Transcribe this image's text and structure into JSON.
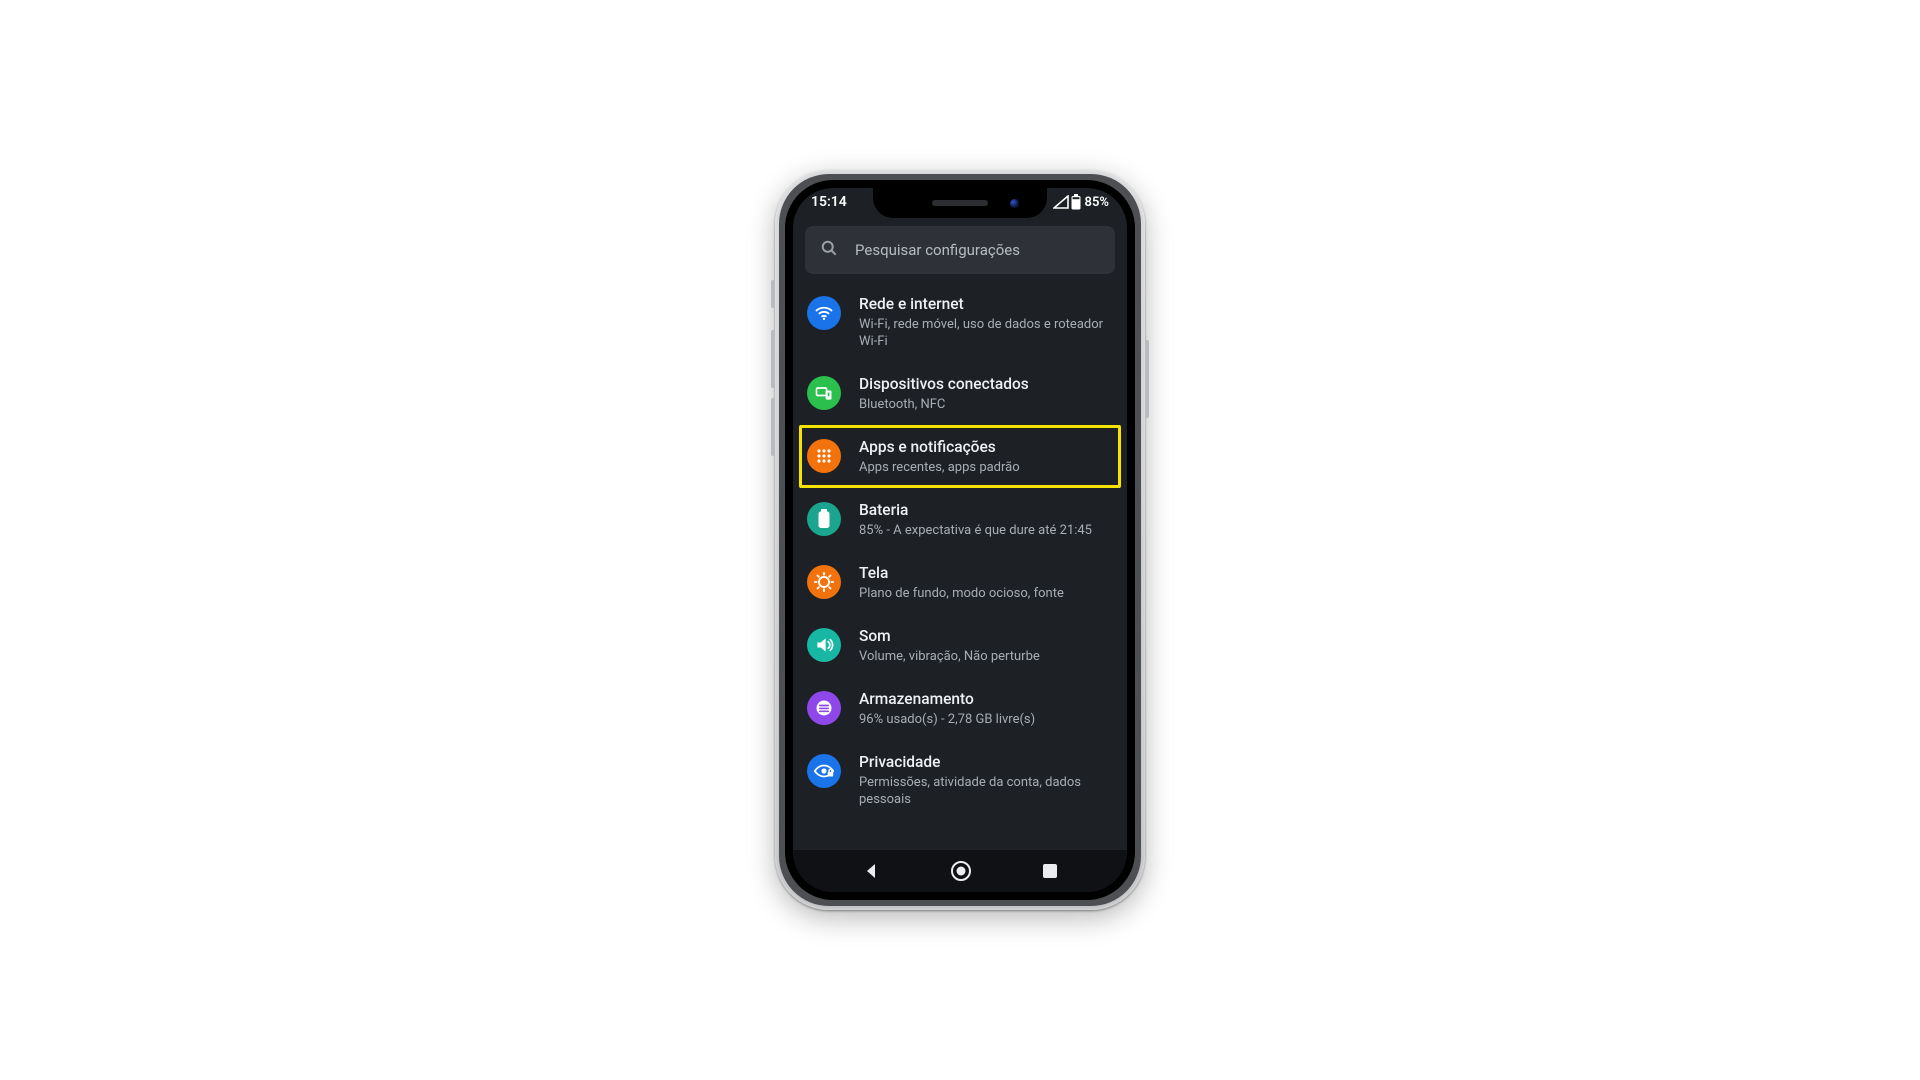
{
  "status": {
    "time": "15:14",
    "battery_text": "85%"
  },
  "search": {
    "placeholder": "Pesquisar configurações"
  },
  "highlight_index": 2,
  "items": [
    {
      "icon": "wifi-icon",
      "color": "blue",
      "title": "Rede e internet",
      "subtitle": "Wi-Fi, rede móvel, uso de dados e roteador Wi-Fi"
    },
    {
      "icon": "devices-icon",
      "color": "green",
      "title": "Dispositivos conectados",
      "subtitle": "Bluetooth, NFC"
    },
    {
      "icon": "apps-icon",
      "color": "orange",
      "title": "Apps e notificações",
      "subtitle": "Apps recentes, apps padrão"
    },
    {
      "icon": "battery-icon",
      "color": "teal",
      "title": "Bateria",
      "subtitle": "85% - A expectativa é que dure até 21:45"
    },
    {
      "icon": "display-icon",
      "color": "orange2",
      "title": "Tela",
      "subtitle": "Plano de fundo, modo ocioso, fonte"
    },
    {
      "icon": "sound-icon",
      "color": "teal2",
      "title": "Som",
      "subtitle": "Volume, vibração, Não perturbe"
    },
    {
      "icon": "storage-icon",
      "color": "purple",
      "title": "Armazenamento",
      "subtitle": "96% usado(s) - 2,78 GB livre(s)"
    },
    {
      "icon": "privacy-icon",
      "color": "blue2",
      "title": "Privacidade",
      "subtitle": "Permissões, atividade da conta, dados pessoais"
    }
  ]
}
